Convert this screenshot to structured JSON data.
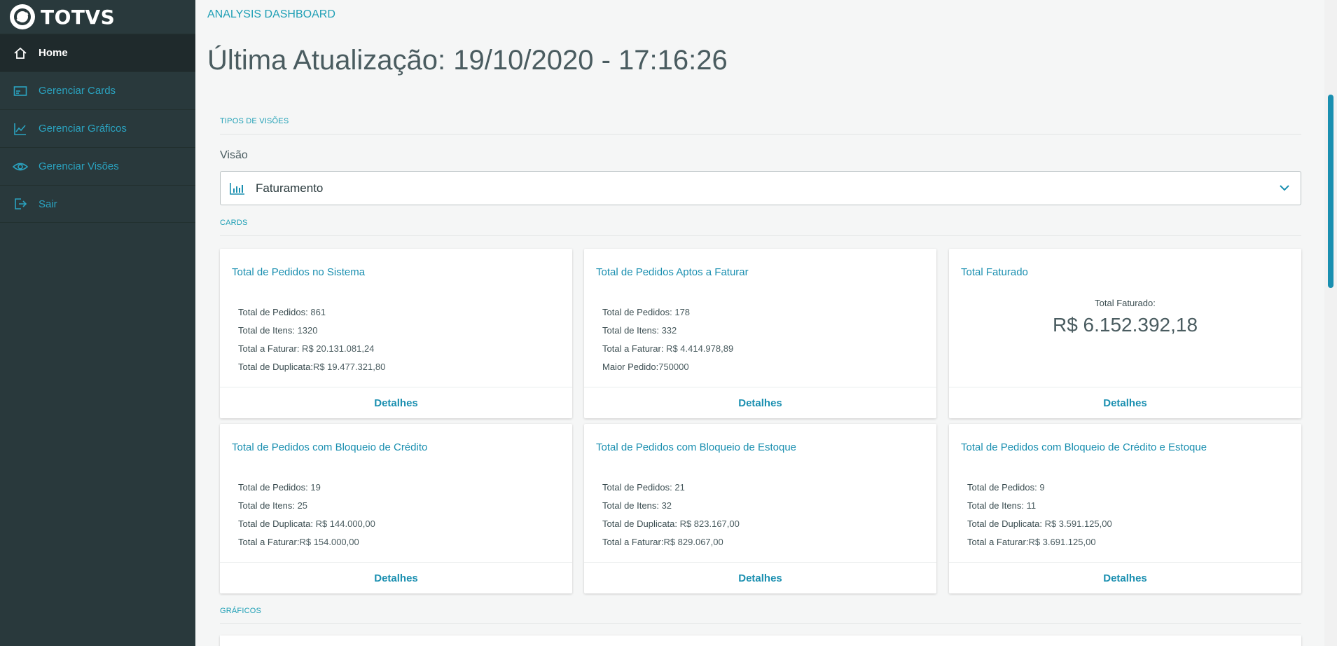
{
  "brand": {
    "name": "TOTVS"
  },
  "sidebar": {
    "items": [
      {
        "label": "Home",
        "icon": "home-icon"
      },
      {
        "label": "Gerenciar Cards",
        "icon": "card-icon"
      },
      {
        "label": "Gerenciar Gráficos",
        "icon": "chart-icon"
      },
      {
        "label": "Gerenciar Visões",
        "icon": "eye-icon"
      },
      {
        "label": "Sair",
        "icon": "logout-icon"
      }
    ]
  },
  "header": {
    "breadcrumb": "ANALYSIS DASHBOARD",
    "title": "Última Atualização: 19/10/2020 - 17:16:26"
  },
  "sections": {
    "views": "TIPOS DE VISÕES",
    "cards": "CARDS",
    "charts": "GRÁFICOS"
  },
  "view_select": {
    "label": "Visão",
    "value": "Faturamento"
  },
  "cards": [
    {
      "title": "Total de Pedidos no Sistema",
      "rows": [
        {
          "k": "Total de Pedidos:",
          "v": " 861"
        },
        {
          "k": "Total de Itens:",
          "v": " 1320"
        },
        {
          "k": "Total a Faturar:",
          "v": " R$ 20.131.081,24"
        },
        {
          "k": "Total de Duplicata:",
          "v": "R$ 19.477.321,80"
        }
      ],
      "footer": "Detalhes"
    },
    {
      "title": "Total de Pedidos Aptos a Faturar",
      "rows": [
        {
          "k": "Total de Pedidos:",
          "v": " 178"
        },
        {
          "k": "Total de Itens:",
          "v": " 332"
        },
        {
          "k": "Total a Faturar:",
          "v": " R$ 4.414.978,89"
        },
        {
          "k": "Maior Pedido:",
          "v": "750000"
        }
      ],
      "footer": "Detalhes"
    },
    {
      "title": "Total Faturado",
      "center_label": "Total Faturado:",
      "center_value": "R$ 6.152.392,18",
      "footer": "Detalhes"
    },
    {
      "title": "Total de Pedidos com Bloqueio de Crédito",
      "rows": [
        {
          "k": "Total de Pedidos:",
          "v": " 19"
        },
        {
          "k": "Total de Itens:",
          "v": " 25"
        },
        {
          "k": "Total de Duplicata:",
          "v": " R$ 144.000,00"
        },
        {
          "k": "Total a Faturar:",
          "v": "R$ 154.000,00"
        }
      ],
      "footer": "Detalhes"
    },
    {
      "title": "Total de Pedidos com Bloqueio de Estoque",
      "rows": [
        {
          "k": "Total de Pedidos:",
          "v": " 21"
        },
        {
          "k": "Total de Itens:",
          "v": " 32"
        },
        {
          "k": "Total de Duplicata:",
          "v": " R$ 823.167,00"
        },
        {
          "k": "Total a Faturar:",
          "v": "R$ 829.067,00"
        }
      ],
      "footer": "Detalhes"
    },
    {
      "title": "Total de Pedidos com Bloqueio de Crédito e Estoque",
      "rows": [
        {
          "k": "Total de Pedidos:",
          "v": " 9"
        },
        {
          "k": "Total de Itens:",
          "v": " 11"
        },
        {
          "k": "Total de Duplicata:",
          "v": " R$ 3.591.125,00"
        },
        {
          "k": "Total a Faturar:",
          "v": "R$ 3.691.125,00"
        }
      ],
      "footer": "Detalhes"
    }
  ],
  "colors": {
    "sidebar_bg": "#29393c",
    "accent": "#1a8fb0",
    "page_bg": "#f5f6f6"
  }
}
